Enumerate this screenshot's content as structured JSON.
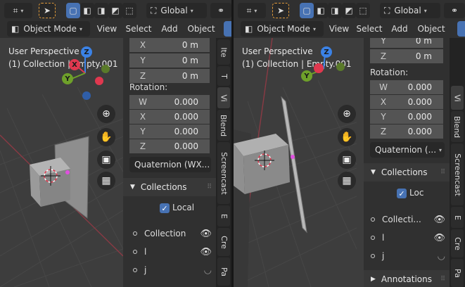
{
  "left": {
    "header": {
      "mode": "Object Mode",
      "menus": [
        "View",
        "Select",
        "Add",
        "Object"
      ],
      "transform_orientation": "Global"
    },
    "viewport": {
      "perspective": "User Perspective",
      "collection": "(1) Collection | Empty.001"
    },
    "panel": {
      "location": [
        {
          "axis": "X",
          "value": "0 m"
        },
        {
          "axis": "Y",
          "value": "0 m"
        },
        {
          "axis": "Z",
          "value": "0 m"
        }
      ],
      "rotation_label": "Rotation:",
      "rotation": [
        {
          "axis": "W",
          "value": "0.000"
        },
        {
          "axis": "X",
          "value": "0.000"
        },
        {
          "axis": "Y",
          "value": "0.000"
        },
        {
          "axis": "Z",
          "value": "0.000"
        }
      ],
      "rotation_mode": "Quaternion (WX...",
      "collections_title": "Collections",
      "local_label": "Local",
      "items": [
        {
          "name": "Collection"
        },
        {
          "name": "l"
        },
        {
          "name": "j"
        }
      ]
    },
    "tabs": [
      "Ite",
      "T",
      "Vi",
      "Blend",
      "Screencast",
      "E",
      "Cre",
      "Pa"
    ]
  },
  "right": {
    "header": {
      "mode": "Object Mode",
      "menus": [
        "View",
        "Select",
        "Add",
        "Object"
      ],
      "transform_orientation": "Global"
    },
    "viewport": {
      "perspective": "User Perspective",
      "collection": "(1) Collection | Empty.001"
    },
    "panel": {
      "location": [
        {
          "axis": "Y",
          "value": "0 m"
        },
        {
          "axis": "Z",
          "value": "0 m"
        }
      ],
      "rotation_label": "Rotation:",
      "rotation": [
        {
          "axis": "W",
          "value": "0.000"
        },
        {
          "axis": "X",
          "value": "0.000"
        },
        {
          "axis": "Y",
          "value": "0.000"
        },
        {
          "axis": "Z",
          "value": "0.000"
        }
      ],
      "rotation_mode": "Quaternion (...",
      "collections_title": "Collections",
      "local_label": "Loc",
      "items": [
        {
          "name": "Collecti..."
        },
        {
          "name": "l"
        },
        {
          "name": "j"
        }
      ],
      "annotations_title": "Annotations"
    },
    "tabs": [
      "Vi",
      "Blend",
      "Screencast",
      "E",
      "Cre",
      "Pa"
    ]
  },
  "gizmo": {
    "x_label": "X",
    "y_label": "Y",
    "z_label": "Z"
  },
  "colors": {
    "x_axis": "#e0384f",
    "y_axis": "#6ea02a",
    "z_axis": "#3b82e6",
    "accent": "#4772b3",
    "origin": "#e0a030"
  }
}
